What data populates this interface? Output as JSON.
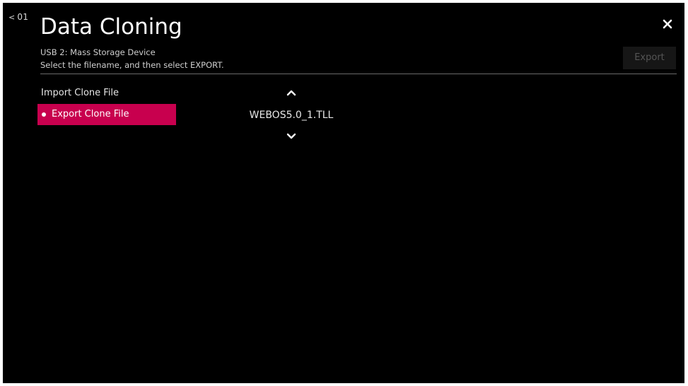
{
  "header": {
    "back_label": "01",
    "title": "Data Cloning",
    "subtitle_device": "USB 2: Mass Storage Device",
    "subtitle_instruction": "Select the filename, and then select EXPORT."
  },
  "actions": {
    "export_label": "Export",
    "export_enabled": false
  },
  "menu": {
    "items": [
      {
        "label": "Import Clone File",
        "selected": false
      },
      {
        "label": "Export Clone File",
        "selected": true
      }
    ]
  },
  "file_picker": {
    "selected_file": "WEBOS5.0_1.TLL"
  },
  "colors": {
    "background": "#000000",
    "accent": "#c8004e",
    "disabled_button": "#161616"
  },
  "icons": [
    "back-chevron-icon",
    "close-icon",
    "chevron-up-icon",
    "chevron-down-icon",
    "selected-dot-icon"
  ]
}
